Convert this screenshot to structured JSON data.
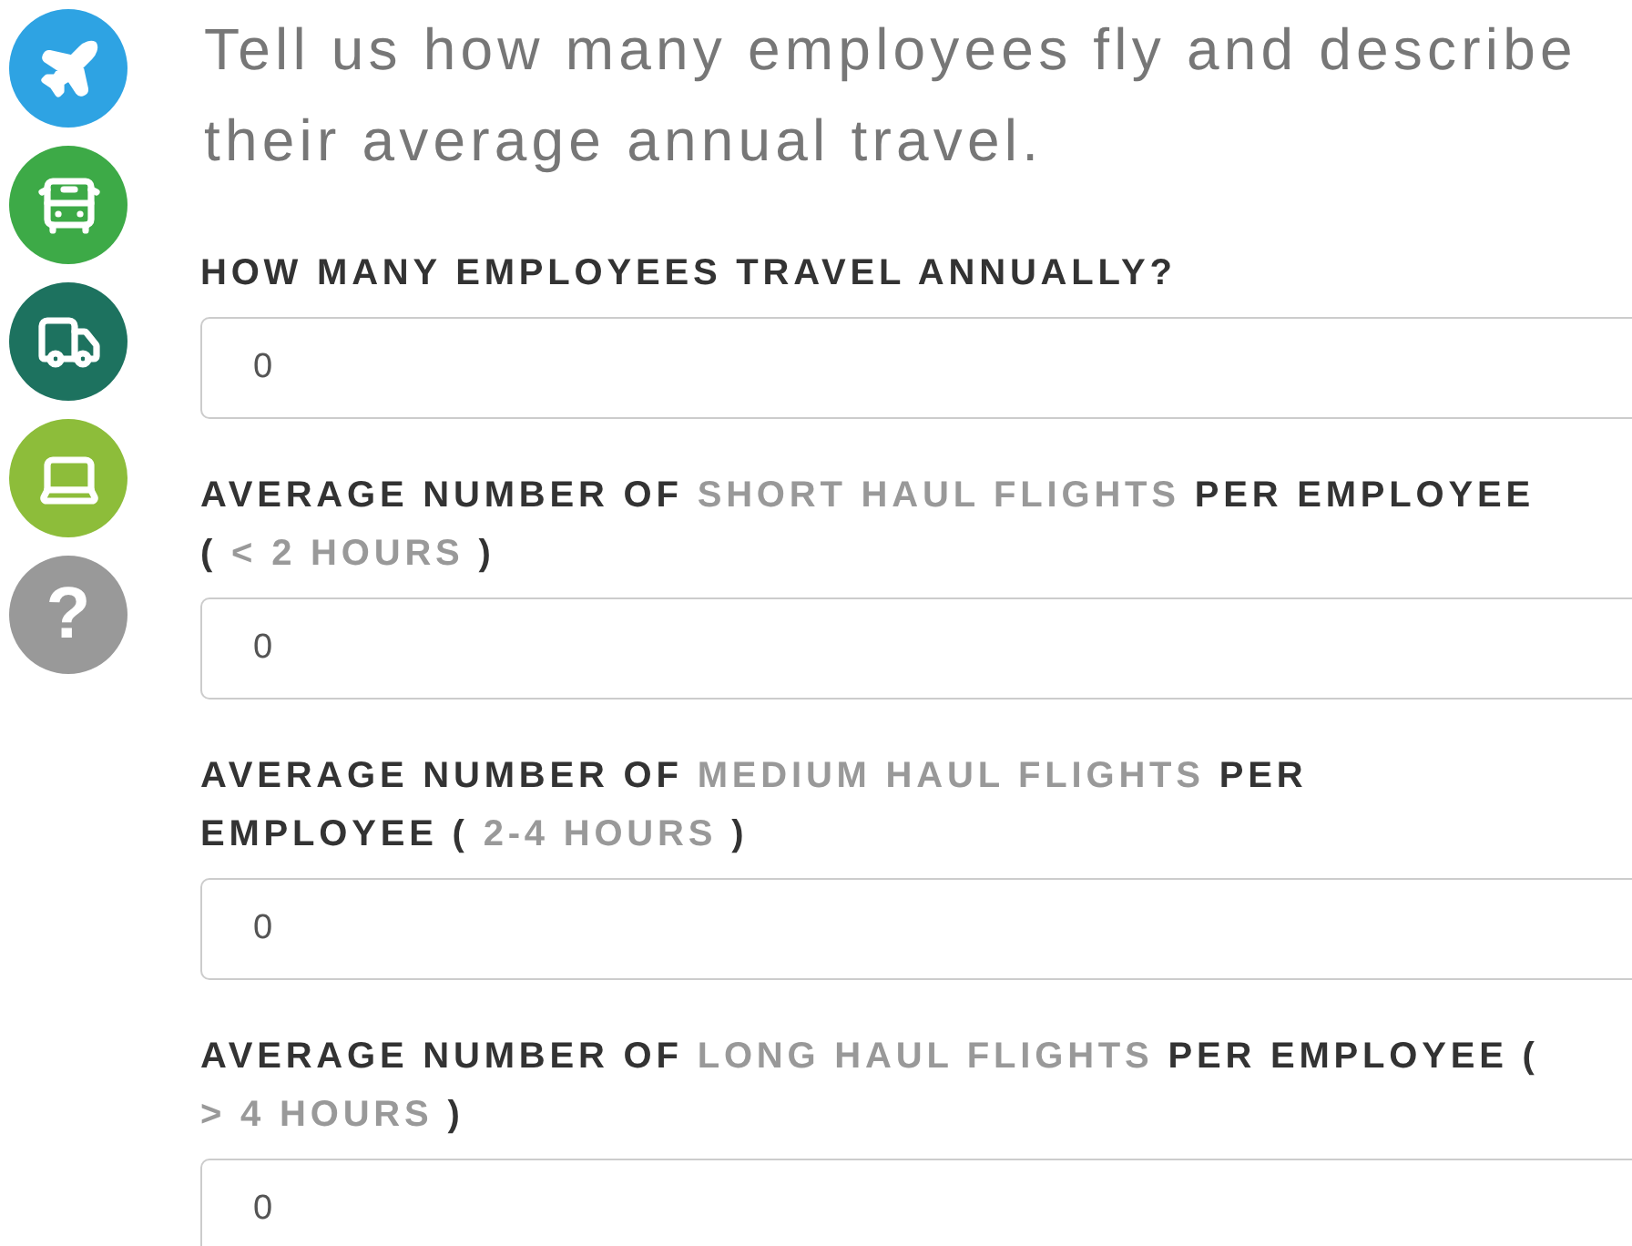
{
  "nav": [
    {
      "kind": "plane",
      "color": "#2ea3e3"
    },
    {
      "kind": "bus",
      "color": "#3daa47"
    },
    {
      "kind": "truck",
      "color": "#1d725f"
    },
    {
      "kind": "laptop",
      "color": "#8dbd3a"
    },
    {
      "kind": "help",
      "color": "#999999",
      "text": "?"
    }
  ],
  "intro": "Tell us how many employees fly and describe their average annual travel.",
  "fields": [
    {
      "label": [
        [
          {
            "text": "HOW MANY EMPLOYEES TRAVEL ANNUALLY?",
            "kind": "plain"
          }
        ]
      ],
      "value": "0"
    },
    {
      "label": [
        [
          {
            "text": "AVERAGE NUMBER OF ",
            "kind": "plain"
          },
          {
            "text": "SHORT HAUL FLIGHTS",
            "kind": "muted"
          },
          {
            "text": " PER EMPLOYEE",
            "kind": "plain"
          }
        ],
        [
          {
            "text": "( ",
            "kind": "plain"
          },
          {
            "text": "< 2 HOURS",
            "kind": "muted"
          },
          {
            "text": " )",
            "kind": "plain"
          }
        ]
      ],
      "value": "0"
    },
    {
      "label": [
        [
          {
            "text": "AVERAGE NUMBER OF ",
            "kind": "plain"
          },
          {
            "text": "MEDIUM HAUL FLIGHTS",
            "kind": "muted"
          },
          {
            "text": " PER",
            "kind": "plain"
          }
        ],
        [
          {
            "text": "EMPLOYEE ( ",
            "kind": "plain"
          },
          {
            "text": "2-4 HOURS",
            "kind": "muted"
          },
          {
            "text": " )",
            "kind": "plain"
          }
        ]
      ],
      "value": "0"
    },
    {
      "label": [
        [
          {
            "text": "AVERAGE NUMBER OF ",
            "kind": "plain"
          },
          {
            "text": "LONG HAUL FLIGHTS",
            "kind": "muted"
          },
          {
            "text": " PER EMPLOYEE (",
            "kind": "plain"
          }
        ],
        [
          {
            "text": "> 4 HOURS",
            "kind": "muted"
          },
          {
            "text": " )",
            "kind": "plain"
          }
        ]
      ],
      "value": "0"
    }
  ]
}
